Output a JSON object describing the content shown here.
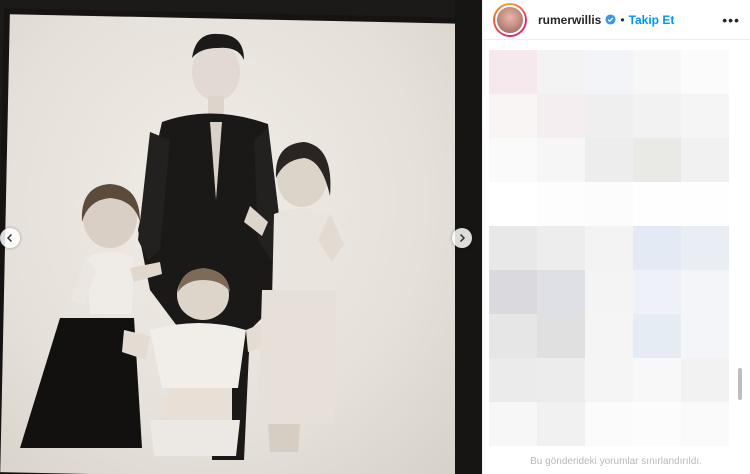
{
  "post": {
    "username": "rumerwillis",
    "follow_label": "Takip Et",
    "separator": "•",
    "more_label": "•••",
    "comments_restricted": "Bu gönderideki yorumlar sınırlandırıldı."
  },
  "icons": {
    "verified": "verified-badge-icon",
    "prev": "chevron-left-icon",
    "next": "chevron-right-icon",
    "more": "more-options-icon"
  },
  "colors": {
    "follow": "#0095f6",
    "verified": "#3897f0",
    "muted_text": "#b9b9b9"
  },
  "blurred_cells": [
    "#f6e9ee",
    "#f3f3f3",
    "#f2f4f7",
    "#f7f7f7",
    "#fbfbfb",
    "#faf5f5",
    "#f4eef1",
    "#efefef",
    "#f2f2f2",
    "#f5f5f5",
    "#fafafa",
    "#f6f6f6",
    "#ededed",
    "#e9e9e6",
    "#f1f1f1",
    "#ffffff",
    "#fdfdfd",
    "#fcfcfc",
    "#fefefe",
    "#fefefe",
    "#e8e8e8",
    "#ededed",
    "#f3f3f3",
    "#e4eaf3",
    "#e9eef5",
    "#d9d9de",
    "#dfe0e6",
    "#f4f4f4",
    "#eef2f8",
    "#f3f5f8",
    "#e6e6e6",
    "#e0e0e0",
    "#f5f5f5",
    "#e6ecf4",
    "#f3f5f9",
    "#ebebeb",
    "#ececec",
    "#f5f5f5",
    "#f8f8f8",
    "#f2f2f2",
    "#f7f7f7",
    "#f1f1f1",
    "#fbfbfb",
    "#fcfcfc",
    "#fafafa"
  ]
}
